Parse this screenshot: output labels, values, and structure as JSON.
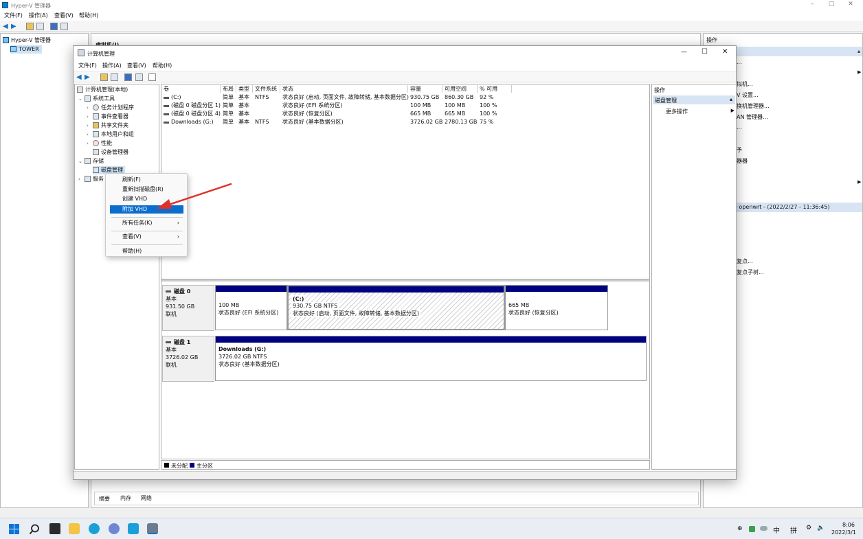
{
  "hyperv": {
    "title": "Hyper-V 管理器",
    "min": "–",
    "max": "▢",
    "close": "✕",
    "menu": [
      "文件(F)",
      "操作(A)",
      "查看(V)",
      "帮助(H)"
    ],
    "tree": [
      "Hyper-V 管理器",
      "TOWER"
    ],
    "center_title": "虚拟机(I)",
    "actions_title": "操作",
    "actions_fragments": [
      "...",
      "",
      "拟机...",
      "V 设置...",
      "换机管理器...",
      "AN 管理器...",
      "...",
      "",
      "予",
      "器器",
      "",
      "",
      "",
      "- openwrt - (2022/2/27 - 11:36:45)",
      "",
      "",
      "",
      "复点...",
      "复点子树..."
    ],
    "bottom_tabs": [
      "摘要",
      "内存",
      "网络"
    ]
  },
  "cm": {
    "title": "计算机管理",
    "min": "—",
    "max": "☐",
    "close": "✕",
    "menu": [
      "文件(F)",
      "操作(A)",
      "查看(V)",
      "帮助(H)"
    ],
    "tree": [
      {
        "label": "计算机管理(本地)",
        "exp": ""
      },
      {
        "label": "系统工具",
        "exp": "⌄"
      },
      {
        "label": "任务计划程序",
        "exp": "›"
      },
      {
        "label": "事件查看器",
        "exp": "›"
      },
      {
        "label": "共享文件夹",
        "exp": "›"
      },
      {
        "label": "本地用户和组",
        "exp": "›"
      },
      {
        "label": "性能",
        "exp": "›"
      },
      {
        "label": "设备管理器",
        "exp": ""
      },
      {
        "label": "存储",
        "exp": "⌄"
      },
      {
        "label": "磁盘管理",
        "exp": ""
      },
      {
        "label": "服务",
        "exp": "›"
      }
    ],
    "columns": [
      "卷",
      "布局",
      "类型",
      "文件系统",
      "状态",
      "容量",
      "可用空间",
      "% 可用"
    ],
    "volumes": [
      {
        "vol": "(C:)",
        "layout": "简单",
        "type": "基本",
        "fs": "NTFS",
        "status": "状态良好 (启动, 页面文件, 故障转储, 基本数据分区)",
        "cap": "930.75 GB",
        "free": "860.30 GB",
        "pct": "92 %"
      },
      {
        "vol": "(磁盘 0 磁盘分区 1)",
        "layout": "简单",
        "type": "基本",
        "fs": "",
        "status": "状态良好 (EFI 系统分区)",
        "cap": "100 MB",
        "free": "100 MB",
        "pct": "100 %"
      },
      {
        "vol": "(磁盘 0 磁盘分区 4)",
        "layout": "简单",
        "type": "基本",
        "fs": "",
        "status": "状态良好 (恢复分区)",
        "cap": "665 MB",
        "free": "665 MB",
        "pct": "100 %"
      },
      {
        "vol": "Downloads (G:)",
        "layout": "简单",
        "type": "基本",
        "fs": "NTFS",
        "status": "状态良好 (基本数据分区)",
        "cap": "3726.02 GB",
        "free": "2780.13 GB",
        "pct": "75 %"
      }
    ],
    "disks": [
      {
        "name": "磁盘 0",
        "kind": "基本",
        "size": "931.50 GB",
        "state": "联机",
        "parts": [
          {
            "title": "",
            "size": "100 MB",
            "status": "状态良好 (EFI 系统分区)"
          },
          {
            "title": "(C:)",
            "size": "930.75 GB NTFS",
            "status": "状态良好 (启动, 页面文件, 故障转储, 基本数据分区)"
          },
          {
            "title": "",
            "size": "665 MB",
            "status": "状态良好 (恢复分区)"
          }
        ]
      },
      {
        "name": "磁盘 1",
        "kind": "基本",
        "size": "3726.02 GB",
        "state": "联机",
        "parts": [
          {
            "title": "Downloads (G:)",
            "size": "3726.02 GB NTFS",
            "status": "状态良好 (基本数据分区)"
          }
        ]
      }
    ],
    "legend": [
      "未分配",
      "主分区"
    ],
    "legend_colors": [
      "#000000",
      "#000080"
    ],
    "actions_title": "操作",
    "actions_section": "磁盘管理",
    "actions_more": "更多操作"
  },
  "context_menu": {
    "items": [
      "刷新(F)",
      "重新扫描磁盘(R)",
      "创建 VHD",
      "附加 VHD",
      "所有任务(K)",
      "查看(V)",
      "帮助(H)"
    ],
    "highlighted": "附加 VHD"
  },
  "taskbar": {
    "time": "8:06",
    "date": "2022/3/1",
    "ime1": "中",
    "ime2": "拼"
  },
  "colors": {
    "accent": "#0b6dcc",
    "partition_bar": "#000080",
    "selection": "#cde3f7",
    "arrow": "#e0302a"
  }
}
